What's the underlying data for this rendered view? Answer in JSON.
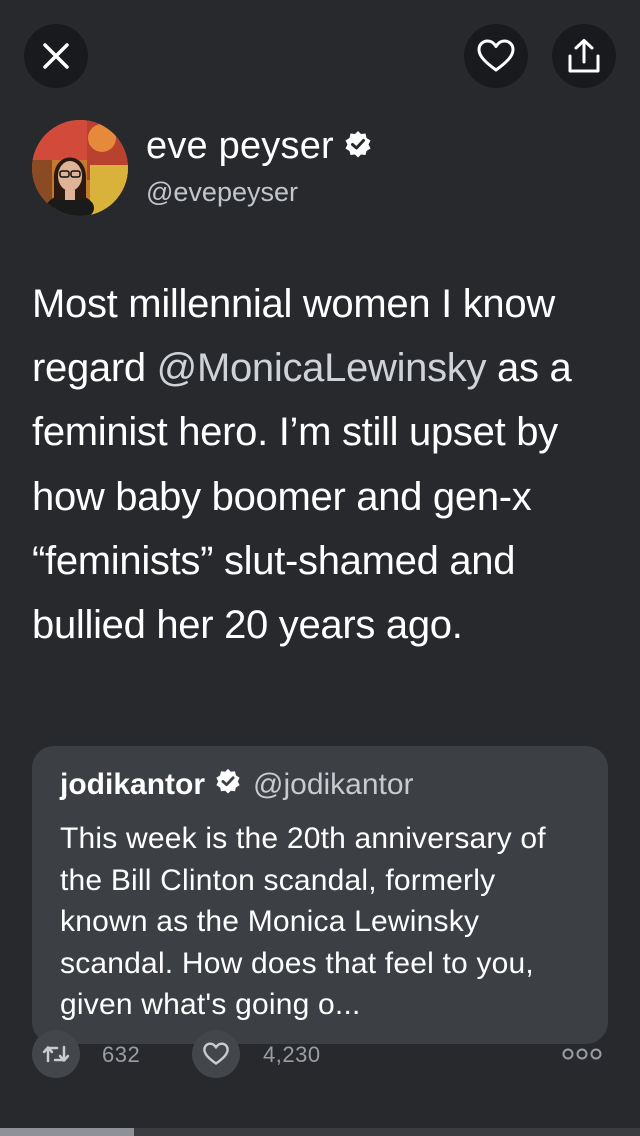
{
  "toolbar": {
    "close_icon": "close-icon",
    "like_icon": "heart-icon",
    "share_icon": "share-icon"
  },
  "tweet": {
    "author_name": "eve peyser",
    "author_handle": "@evepeyser",
    "verified": true,
    "text_before": "Most millennial women I know regard ",
    "mention": "@MonicaLewinsky",
    "text_after": " as a feminist hero. I’m still upset by how baby boomer and gen-x “feminists” slut-shamed and bullied her 20 years ago."
  },
  "quoted_tweet": {
    "author_name": "jodikantor",
    "author_handle": "@jodikantor",
    "verified": true,
    "text": "This week is the 20th anniversary of the Bill Clinton scandal, formerly known as the Monica Lewinsky scandal. How does that feel to you, given what's going o..."
  },
  "actions": {
    "retweet_count": "632",
    "like_count": "4,230",
    "more_icon": "more-icon"
  },
  "progress": {
    "fraction": 0.21
  },
  "colors": {
    "background": "#27292d",
    "card": "#3c3f44",
    "button": "#181a1d"
  }
}
